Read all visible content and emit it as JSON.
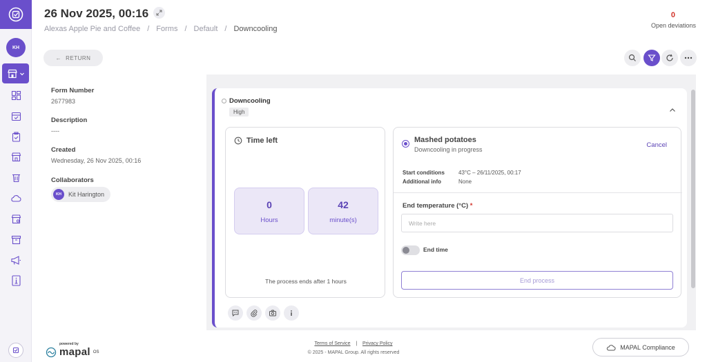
{
  "header": {
    "title": "26 Nov 2025, 00:16",
    "breadcrumb": [
      "Alexas Apple Pie and Coffee",
      "/",
      "Forms",
      "/",
      "Default",
      "/",
      "Downcooling"
    ],
    "deviations_count": "0",
    "deviations_label": "Open deviations"
  },
  "sidebar": {
    "user_initials": "KH",
    "icons": [
      "dashboard-icon",
      "calendar-check-icon",
      "clipboard-check-icon",
      "storefront-icon",
      "trash-icon",
      "cloud-icon",
      "store-settings-icon",
      "archive-icon",
      "megaphone-icon",
      "info-document-icon"
    ]
  },
  "toolbar": {
    "return_label": "RETURN"
  },
  "form_info": {
    "form_number_label": "Form Number",
    "form_number": "2677983",
    "description_label": "Description",
    "description": "----",
    "created_label": "Created",
    "created": "Wednesday, 26 Nov 2025, 00:16",
    "collaborators_label": "Collaborators",
    "collaborator_initials": "KH",
    "collaborator_name": "Kit Harington"
  },
  "card": {
    "title": "Downcooling",
    "priority": "High",
    "timer": {
      "title": "Time left",
      "hours_value": "0",
      "hours_label": "Hours",
      "minutes_value": "42",
      "minutes_label": "minute(s)",
      "note": "The process ends after 1 hours"
    },
    "task": {
      "title": "Mashed potatoes",
      "status": "Downcooling in progress",
      "cancel_label": "Cancel",
      "start_conditions_label": "Start conditions",
      "start_conditions_value": "43°C – 26/11/2025, 00:17",
      "additional_info_label": "Additional info",
      "additional_info_value": "None",
      "end_temp_label": "End temperature (°C)",
      "required_marker": "*",
      "end_temp_placeholder": "Write here",
      "end_time_label": "End time",
      "end_process_label": "End process"
    }
  },
  "footer": {
    "powered_by": "powered by",
    "brand": "mapal",
    "brand_suffix": "OS",
    "terms": "Terms of Service",
    "separator": "|",
    "privacy": "Privacy Policy",
    "copyright": "© 2025 - MAPAL Group. All rights reserved",
    "compliance_label": "MAPAL Compliance"
  },
  "colors": {
    "accent": "#6a4fcb",
    "danger": "#d2342b"
  }
}
